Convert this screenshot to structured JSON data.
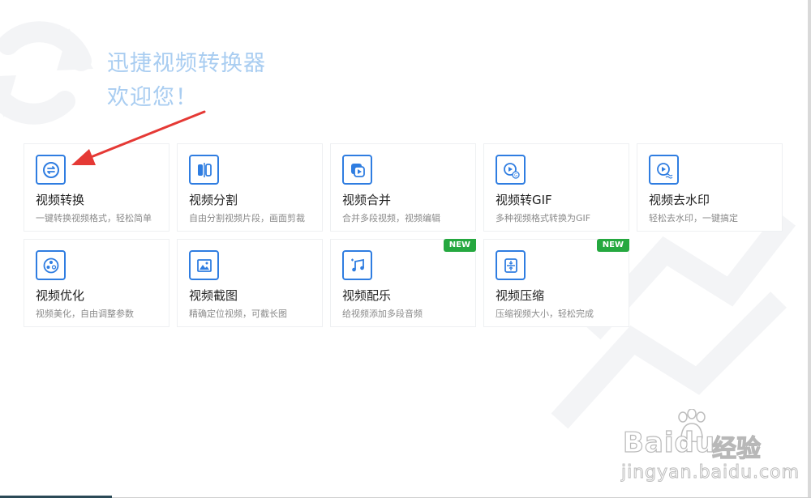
{
  "header": {
    "line1": "迅捷视频转换器",
    "line2": "欢迎您！"
  },
  "tools": [
    {
      "title": "视频转换",
      "desc": "一键转换视频格式，轻松简单",
      "icon": "convert-icon",
      "badge": ""
    },
    {
      "title": "视频分割",
      "desc": "自由分割视频片段，画面剪裁",
      "icon": "split-icon",
      "badge": ""
    },
    {
      "title": "视频合并",
      "desc": "合并多段视频，视频编辑",
      "icon": "merge-icon",
      "badge": ""
    },
    {
      "title": "视频转GIF",
      "desc": "多种视频格式转换为GIF",
      "icon": "gif-icon",
      "badge": ""
    },
    {
      "title": "视频去水印",
      "desc": "轻松去水印，一键搞定",
      "icon": "watermark-remove-icon",
      "badge": ""
    },
    {
      "title": "视频优化",
      "desc": "视频美化，自由调整参数",
      "icon": "optimize-icon",
      "badge": ""
    },
    {
      "title": "视频截图",
      "desc": "精确定位视频，可截长图",
      "icon": "screenshot-icon",
      "badge": ""
    },
    {
      "title": "视频配乐",
      "desc": "给视频添加多段音频",
      "icon": "music-icon",
      "badge": "NEW"
    },
    {
      "title": "视频压缩",
      "desc": "压缩视频大小，轻松完成",
      "icon": "compress-icon",
      "badge": "NEW"
    }
  ],
  "watermark": {
    "brand_latin": "Baidu",
    "brand_cn": "经验",
    "url": "jingyan.baidu.com"
  },
  "colors": {
    "accent": "#2f7de1",
    "welcome_text": "#a9cdf1",
    "badge": "#25a83f",
    "annotation_arrow": "#e53935"
  }
}
